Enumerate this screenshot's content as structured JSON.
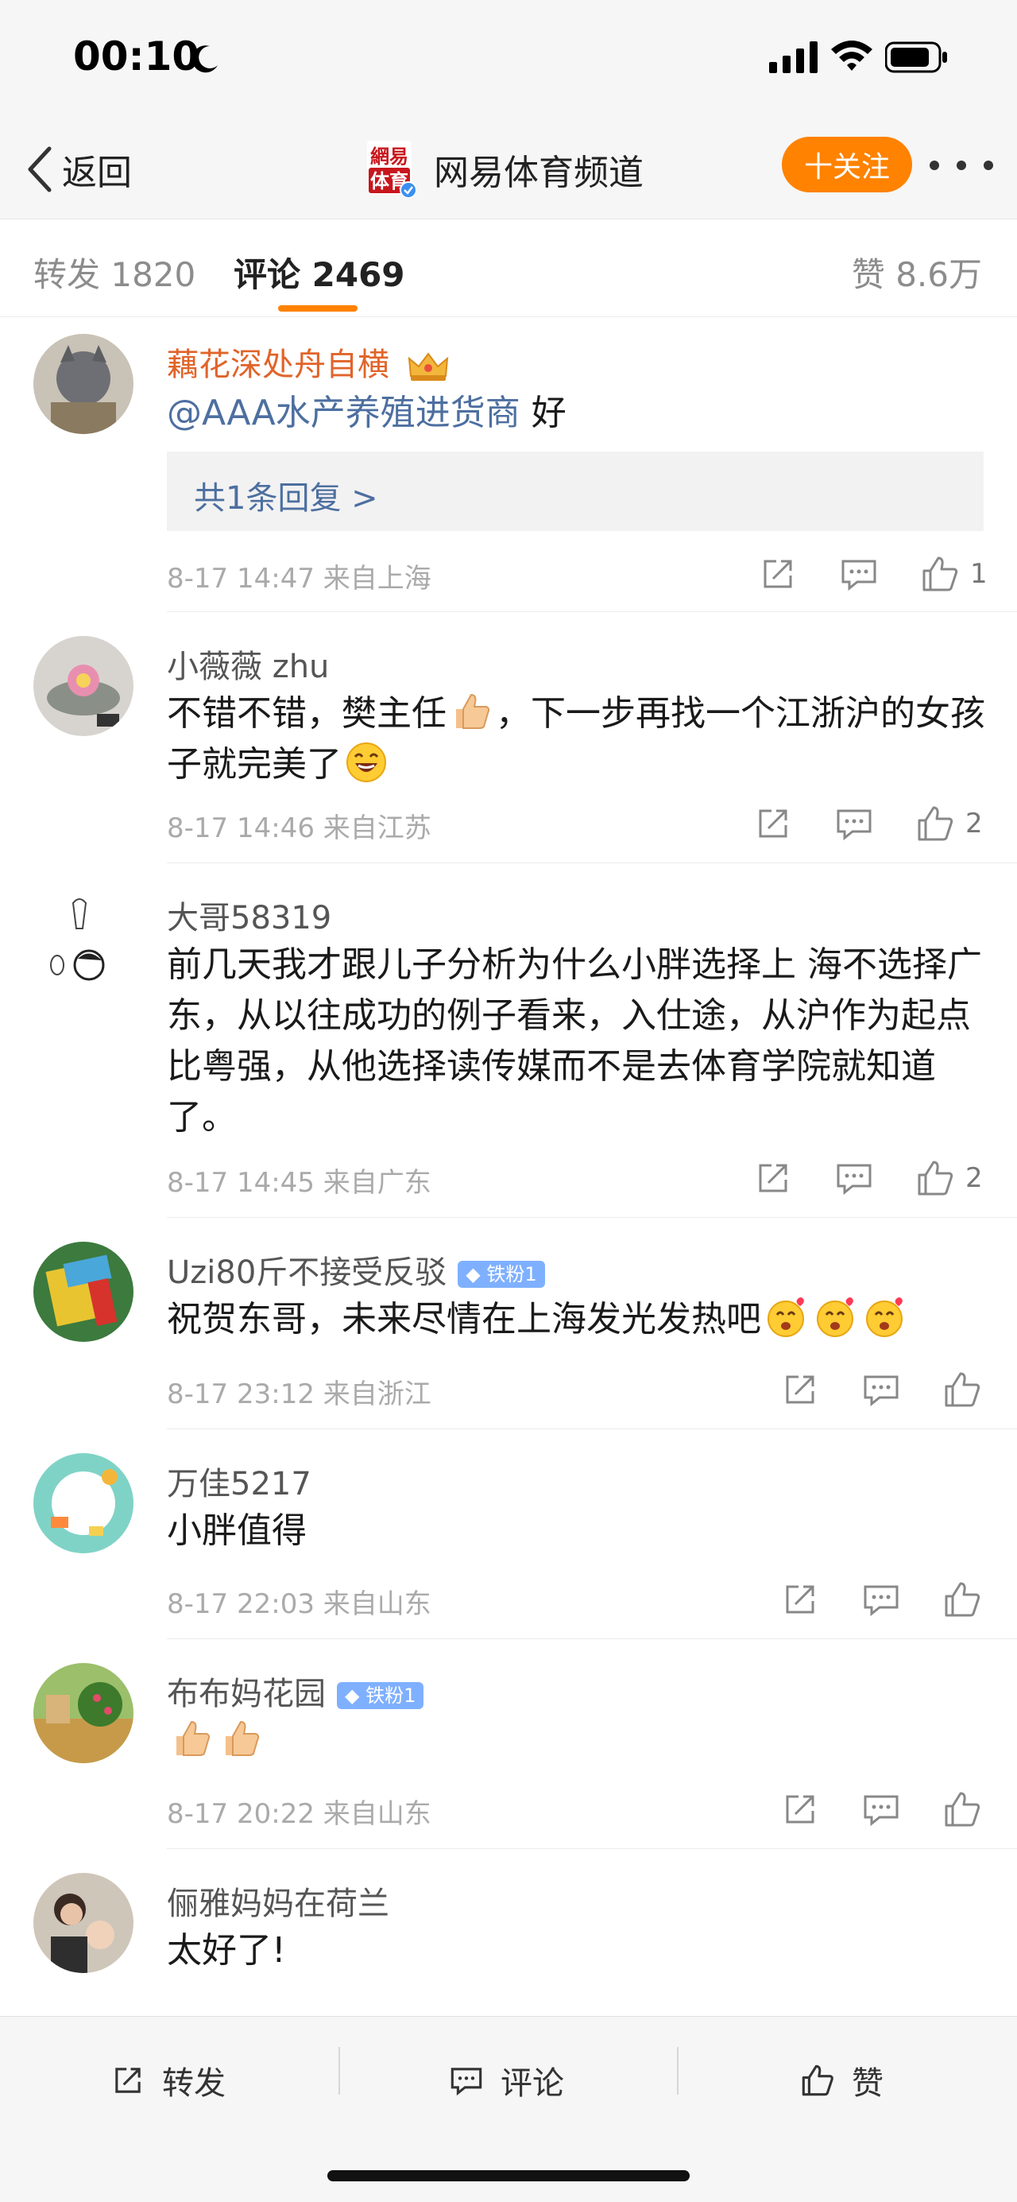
{
  "status": {
    "time": "00:10"
  },
  "nav": {
    "back_label": "返回",
    "logo_text_top": "網易",
    "logo_text_bottom": "体育",
    "channel_name": "网易体育频道",
    "follow_label": "十关注"
  },
  "tabs": {
    "repost": "转发 1820",
    "comment": "评论 2469",
    "like": "赞 8.6万"
  },
  "colors": {
    "accent": "#ff8200",
    "link": "#4d6fa0",
    "vip_name": "#e1642a",
    "fan_badge": "#7fb0ff"
  },
  "comments": [
    {
      "name": "藕花深处舟自横",
      "mention": "@AAA水产养殖进货商",
      "text": " 好",
      "reply_link": "共1条回复 >",
      "meta": "8-17 14:47  来自上海",
      "likes": "1"
    },
    {
      "name": "小薇薇 zhu",
      "text_a": "不错不错，樊主任",
      "text_b": "，下一步再找一个江浙沪的女孩子就完美了",
      "meta": "8-17 14:46  来自江苏",
      "likes": "2"
    },
    {
      "name": "大哥58319",
      "text": "前几天我才跟儿子分析为什么小胖选择上 海不选择广 东，从以往成功的例子看来，入仕途，从沪作为起点比粤强，从他选择读传媒而不是去体育学院就知道了。",
      "meta": "8-17 14:45  来自广东",
      "likes": "2"
    },
    {
      "name": "Uzi80斤不接受反驳",
      "badge": "铁粉1",
      "text": "祝贺东哥，未来尽情在上海发光发热吧",
      "meta": "8-17 23:12  来自浙江"
    },
    {
      "name": "万佳5217",
      "text": "小胖值得",
      "meta": "8-17 22:03  来自山东"
    },
    {
      "name": "布布妈花园",
      "badge": "铁粉1",
      "meta": "8-17 20:22  来自山东"
    },
    {
      "name": "俪雅妈妈在荷兰",
      "text": "太好了!"
    }
  ],
  "bottom_bar": {
    "repost": "转发",
    "comment": "评论",
    "like": "赞"
  },
  "icons": [
    "back-chevron-icon",
    "moon-icon",
    "signal-icon",
    "wifi-icon",
    "battery-icon",
    "verified-icon",
    "share-icon",
    "comment-icon",
    "like-icon",
    "crown-icon",
    "fan-badge-icon",
    "thumbs-up-emoji-icon",
    "laugh-emoji-icon",
    "love-emoji-icon"
  ]
}
